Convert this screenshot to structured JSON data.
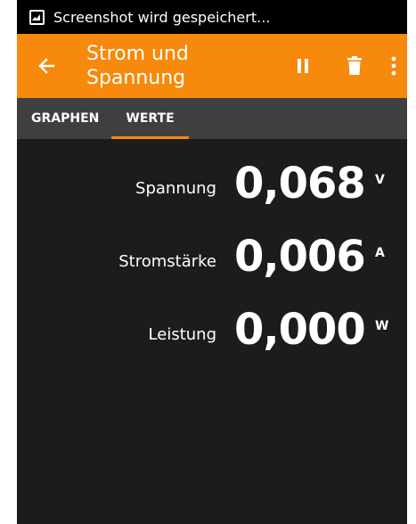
{
  "status_bar": {
    "notification_text": "Screenshot wird gespeichert..."
  },
  "toolbar": {
    "title_line1": "Strom und",
    "title_line2": "Spannung",
    "background_color": "#f7890c",
    "icons": [
      "back-arrow-icon",
      "pause-icon",
      "trash-icon",
      "more-vert-icon"
    ]
  },
  "tabs": [
    {
      "label": "GRAPHEN",
      "active": false
    },
    {
      "label": "WERTE",
      "active": true
    }
  ],
  "values": [
    {
      "label": "Spannung",
      "value": "0,068",
      "unit": "V"
    },
    {
      "label": "Stromstärke",
      "value": "0,006",
      "unit": "A"
    },
    {
      "label": "Leistung",
      "value": "0,000",
      "unit": "W"
    }
  ]
}
